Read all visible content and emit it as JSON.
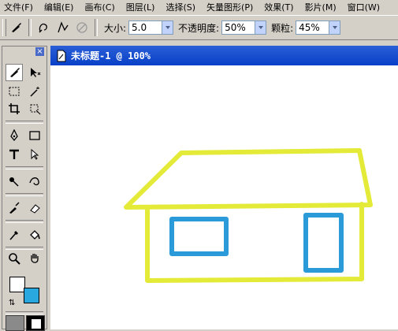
{
  "menu": [
    "文件(F)",
    "编辑(E)",
    "画布(C)",
    "图层(L)",
    "选择(S)",
    "矢量图形(P)",
    "效果(T)",
    "影片(M)",
    "窗口(W)"
  ],
  "options": {
    "size_label": "大小:",
    "size_value": "5.0",
    "opacity_label": "不透明度:",
    "opacity_value": "50%",
    "grain_label": "颗粒:",
    "grain_value": "45%"
  },
  "document": {
    "title": "未标题-1 @ 100%"
  },
  "colors": {
    "foreground": "#ffffff",
    "background": "#29a8e0",
    "house_outline": "#e4ea38",
    "windows": "#2a9ad8",
    "title_bar": "#0a46c8"
  }
}
